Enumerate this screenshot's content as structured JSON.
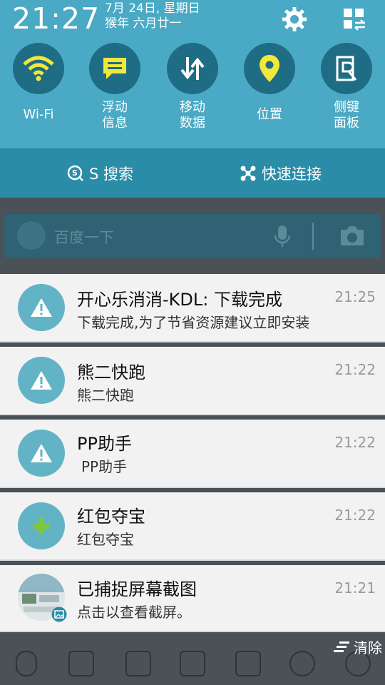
{
  "status": {
    "time": "21:27",
    "date_line1": "7月 24日, 星期日",
    "date_line2": "猴年 六月廿一"
  },
  "quick_settings": [
    {
      "label": "Wi-Fi",
      "icon": "wifi-icon"
    },
    {
      "label": "浮动\n信息",
      "icon": "floating-message-icon"
    },
    {
      "label": "移动\n数据",
      "icon": "mobile-data-icon"
    },
    {
      "label": "位置",
      "icon": "location-icon"
    },
    {
      "label": "侧键\n面板",
      "icon": "side-panel-icon"
    }
  ],
  "search_bar": {
    "s_search_label": "S 搜索",
    "quick_connect_label": "快速连接"
  },
  "background_app": {
    "search_placeholder": "百度一下"
  },
  "notifications": [
    {
      "title": "开心乐消消-KDL: 下载完成",
      "subtitle": "下载完成,为了节省资源建议立即安装",
      "time": "21:25",
      "icon": "warning-icon"
    },
    {
      "title": "熊二快跑",
      "subtitle": "熊二快跑",
      "time": "21:22",
      "icon": "warning-icon"
    },
    {
      "title": " PP助手",
      "subtitle": "PP助手",
      "time": "21:22",
      "icon": "warning-icon"
    },
    {
      "title": "红包夺宝",
      "subtitle": "红包夺宝",
      "time": "21:22",
      "icon": "plus-icon"
    },
    {
      "title": "已捕捉屏幕截图",
      "subtitle": "点击以查看截屏。",
      "time": "21:21",
      "icon": "screenshot-thumbnail"
    }
  ],
  "clear_label": "清除",
  "colors": {
    "panel_teal": "#4aa9c4",
    "icon_circle": "#1f6c85",
    "accent_yellow": "#f1e93a",
    "warning_circle": "#62b3c6",
    "plus_green": "#7bc93a"
  }
}
